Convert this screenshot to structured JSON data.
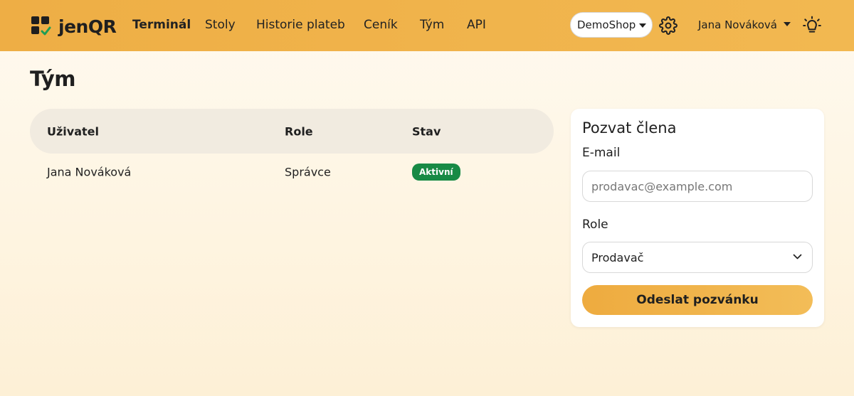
{
  "brand": {
    "name": "jenQR"
  },
  "nav": {
    "items": [
      {
        "label": "Terminál",
        "active": true
      },
      {
        "label": "Stoly"
      },
      {
        "label": "Historie plateb"
      },
      {
        "label": "Ceník"
      },
      {
        "label": "Tým"
      },
      {
        "label": "API"
      }
    ],
    "shop_selector": "DemoShop",
    "settings_icon": "gear-icon",
    "user_name": "Jana Nováková",
    "theme_icon": "lightbulb-icon"
  },
  "page": {
    "title": "Tým"
  },
  "team_table": {
    "columns": [
      "Uživatel",
      "Role",
      "Stav"
    ],
    "rows": [
      {
        "user": "Jana Nováková",
        "role": "Správce",
        "status": "Aktivní"
      }
    ]
  },
  "invite_form": {
    "title": "Pozvat člena",
    "email_label": "E-mail",
    "email_placeholder": "prodavac@example.com",
    "email_value": "",
    "role_label": "Role",
    "role_selected": "Prodavač",
    "submit_label": "Odeslat pozvánku"
  },
  "colors": {
    "navbar": "#eeae45",
    "accent": "#f0b34a",
    "status_active": "#178a45",
    "logo_check": "#1f9d55"
  }
}
